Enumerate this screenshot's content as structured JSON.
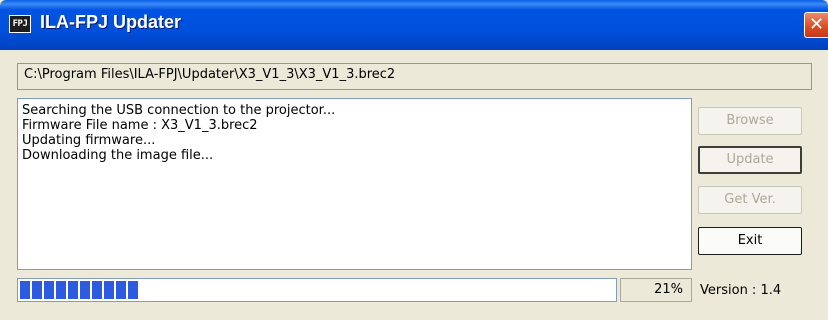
{
  "window": {
    "title": "ILA-FPJ Updater",
    "icon_text": "FPJ",
    "close_glyph": "✕"
  },
  "path_field": {
    "value": "C:\\Program Files\\ILA-FPJ\\Updater\\X3_V1_3\\X3_V1_3.brec2"
  },
  "log": {
    "lines": [
      "Searching the USB connection to the projector...",
      "Firmware File name : X3_V1_3.brec2",
      "Updating firmware...",
      "Downloading the image file..."
    ]
  },
  "buttons": {
    "browse": {
      "label": "Browse",
      "enabled": false
    },
    "update": {
      "label": "Update",
      "enabled": false
    },
    "get_ver": {
      "label": "Get Ver.",
      "enabled": false
    },
    "exit": {
      "label": "Exit",
      "enabled": true
    }
  },
  "progress": {
    "percent_text": "21%",
    "fraction": 0.21
  },
  "version": {
    "text": "Version : 1.4"
  },
  "colors": {
    "titlebar": "#0050DD",
    "progress_block": "#2C5BE0",
    "window_bg": "#ECE9D8"
  }
}
